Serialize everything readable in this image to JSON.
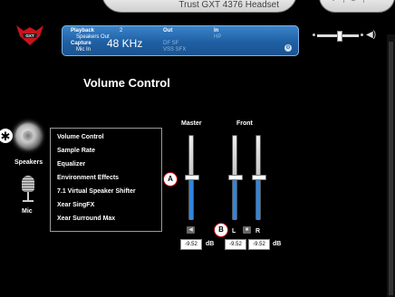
{
  "window": {
    "title": "Trust GXT 4376 Headset",
    "buttons": {
      "info": "i",
      "settings": "⚙",
      "minimize": "—",
      "close": "✕"
    }
  },
  "status": {
    "playback_label": "Playback",
    "playback_value": "2",
    "playback_sub": "Speakers Out",
    "capture_label": "Capture",
    "capture_sub": "Mic In",
    "frequency": "48 KHz",
    "out_label": "Out",
    "out_sub1": "DF   SF",
    "out_sub2": "VSS  SFX",
    "in_label": "In",
    "in_sub": "HP"
  },
  "master_slider": {
    "level": 0.55
  },
  "heading": "Volume Control",
  "devices": [
    {
      "label": "Speakers",
      "icon": "speaker-icon"
    },
    {
      "label": "Mic",
      "icon": "microphone-icon"
    }
  ],
  "annotations": {
    "star": "✱",
    "a": "A",
    "b": "B"
  },
  "menu": [
    "Volume Control",
    "Sample Rate",
    "Equalizer",
    "Environment Effects",
    "7.1 Virtual Speaker Shifter",
    "Xear SingFX",
    "Xear Surround Max"
  ],
  "channels": {
    "master_label": "Master",
    "front_label": "Front",
    "master": {
      "level": 0.5,
      "db": "-9.52"
    },
    "left": {
      "label": "L",
      "level": 0.5,
      "db": "-9.52"
    },
    "right": {
      "label": "R",
      "level": 0.5,
      "db": "-9.52"
    },
    "db_unit": "dB"
  },
  "colors": {
    "accent": "#2e86e0",
    "panel": "#1f5fa3",
    "badge_border": "#b00"
  }
}
